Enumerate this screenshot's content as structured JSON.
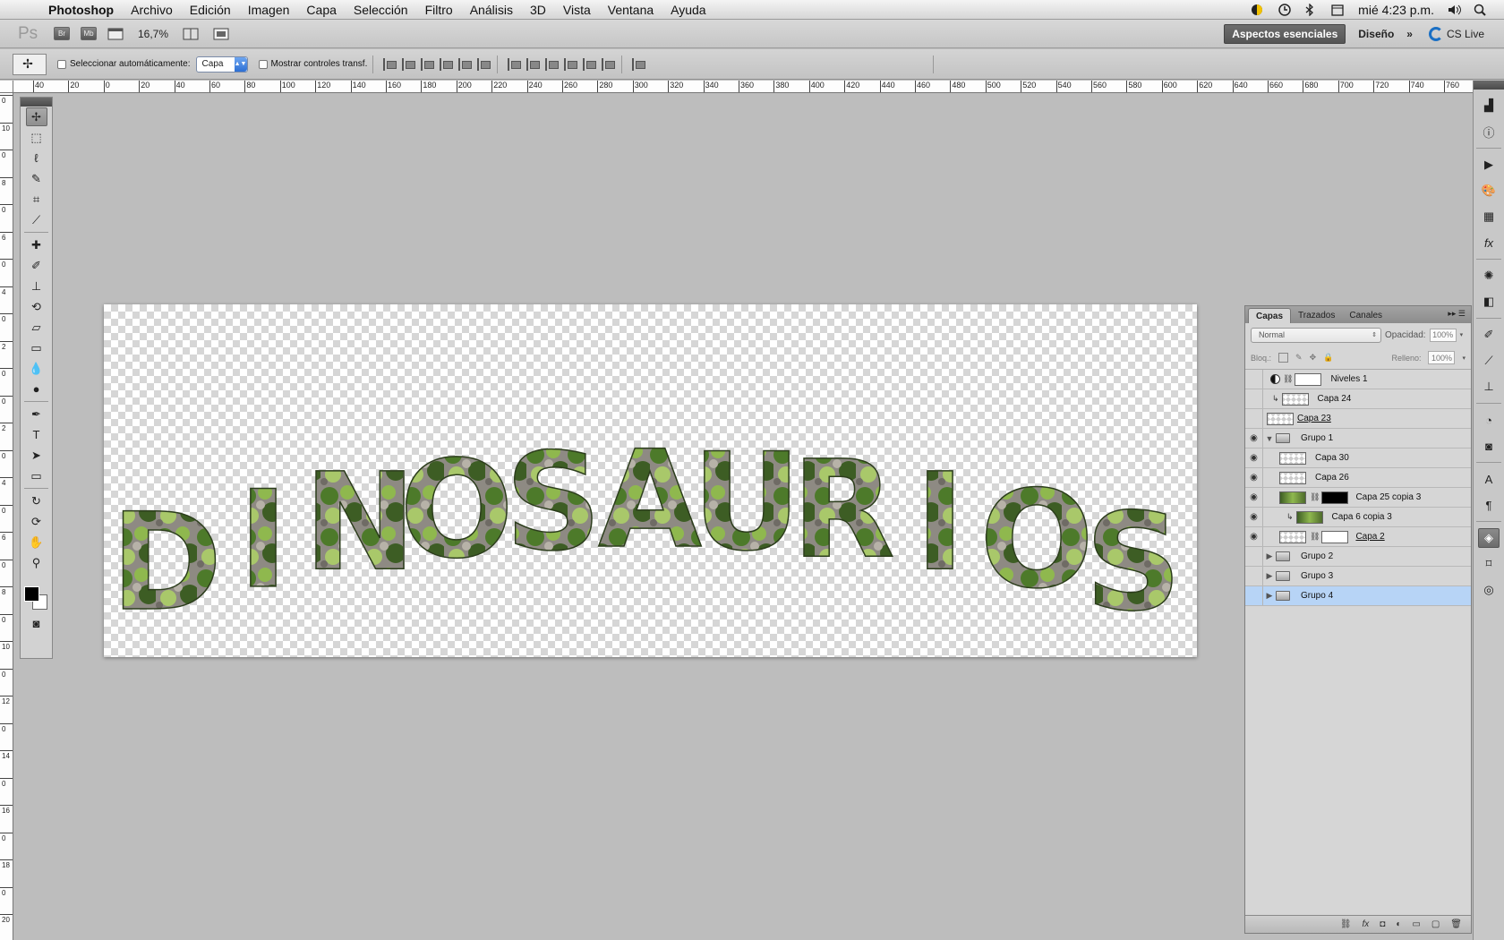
{
  "menubar": {
    "app_name": "Photoshop",
    "menus": [
      "Archivo",
      "Edición",
      "Imagen",
      "Capa",
      "Selección",
      "Filtro",
      "Análisis",
      "3D",
      "Vista",
      "Ventana",
      "Ayuda"
    ],
    "clock": "mié 4:23 p.m."
  },
  "appbar": {
    "logo": "Ps",
    "bridge": "Br",
    "minibridge": "Mb",
    "zoom": "16,7%",
    "workspace_active": "Aspectos esenciales",
    "workspace_design": "Diseño",
    "more": "»",
    "cslive": "CS Live"
  },
  "options": {
    "autoselect_label": "Seleccionar automáticamente:",
    "autoselect_value": "Capa",
    "transform_label": "Mostrar controles transf."
  },
  "ruler": {
    "h_labels": [
      "40",
      "20",
      "0",
      "20",
      "40",
      "60",
      "80",
      "100",
      "120",
      "140",
      "160",
      "180",
      "200",
      "220",
      "240",
      "260",
      "280",
      "300",
      "320",
      "340",
      "360",
      "380",
      "400",
      "420",
      "440",
      "460",
      "480",
      "500",
      "520",
      "540",
      "560",
      "580",
      "600",
      "620",
      "640",
      "660",
      "680",
      "700",
      "720",
      "740",
      "760"
    ],
    "v_labels": [
      "0",
      "10",
      "0",
      "8",
      "0",
      "6",
      "0",
      "4",
      "0",
      "2",
      "0",
      "0",
      "2",
      "0",
      "4",
      "0",
      "6",
      "0",
      "8",
      "0",
      "10",
      "0",
      "12",
      "0",
      "14",
      "0",
      "16",
      "0",
      "18",
      "0",
      "20"
    ]
  },
  "canvas": {
    "title_text": "DINOSAURIOS"
  },
  "layers_panel": {
    "tabs": [
      "Capas",
      "Trazados",
      "Canales"
    ],
    "blend_mode": "Normal",
    "opacity_label": "Opacidad:",
    "opacity_value": "100%",
    "lock_label": "Bloq.:",
    "fill_label": "Relleno:",
    "fill_value": "100%",
    "layers": [
      {
        "name": "Niveles 1",
        "visible": false
      },
      {
        "name": "Capa 24",
        "visible": false
      },
      {
        "name": "Capa 23",
        "visible": false
      },
      {
        "name": "Grupo 1",
        "visible": true
      },
      {
        "name": "Capa 30",
        "visible": true
      },
      {
        "name": "Capa 26",
        "visible": true
      },
      {
        "name": "Capa 25 copia 3",
        "visible": true
      },
      {
        "name": "Capa 6 copia 3",
        "visible": true
      },
      {
        "name": "Capa 2",
        "visible": true
      },
      {
        "name": "Grupo 2",
        "visible": false
      },
      {
        "name": "Grupo 3",
        "visible": false
      },
      {
        "name": "Grupo 4",
        "visible": false
      }
    ]
  },
  "colors": {
    "selection": "#b7d4f6",
    "moss_dark": "#3d5d24",
    "moss_light": "#8fb84e",
    "stone": "#8e8a83"
  }
}
